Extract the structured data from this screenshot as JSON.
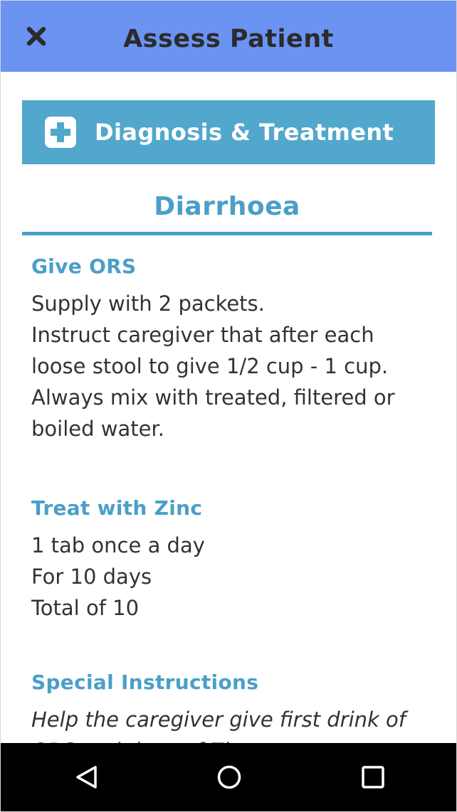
{
  "header": {
    "title": "Assess Patient",
    "close_icon": "close-icon",
    "background_color": "#6a93f2"
  },
  "banner": {
    "icon": "plus-square-icon",
    "label": "Diagnosis & Treatment",
    "background_color": "#51a7cc"
  },
  "condition": {
    "title": "Diarrhoea",
    "accent_color": "#4a9fc9"
  },
  "sections": [
    {
      "heading": "Give ORS",
      "lines": [
        "Supply with 2 packets.",
        "Instruct caregiver that after each",
        "loose stool to give 1/2 cup - 1 cup.",
        "Always mix with treated, filtered or",
        "boiled water."
      ]
    },
    {
      "heading": "Treat with Zinc",
      "lines": [
        "1 tab once a day",
        "For 10 days",
        "Total of 10"
      ]
    },
    {
      "heading": "Special Instructions",
      "lines": [
        "Help the caregiver give first drink of",
        "ORS and dose of Zinc now."
      ]
    }
  ],
  "navbar": {
    "back_icon": "back-triangle-icon",
    "home_icon": "home-circle-icon",
    "recents_icon": "recents-square-icon"
  }
}
